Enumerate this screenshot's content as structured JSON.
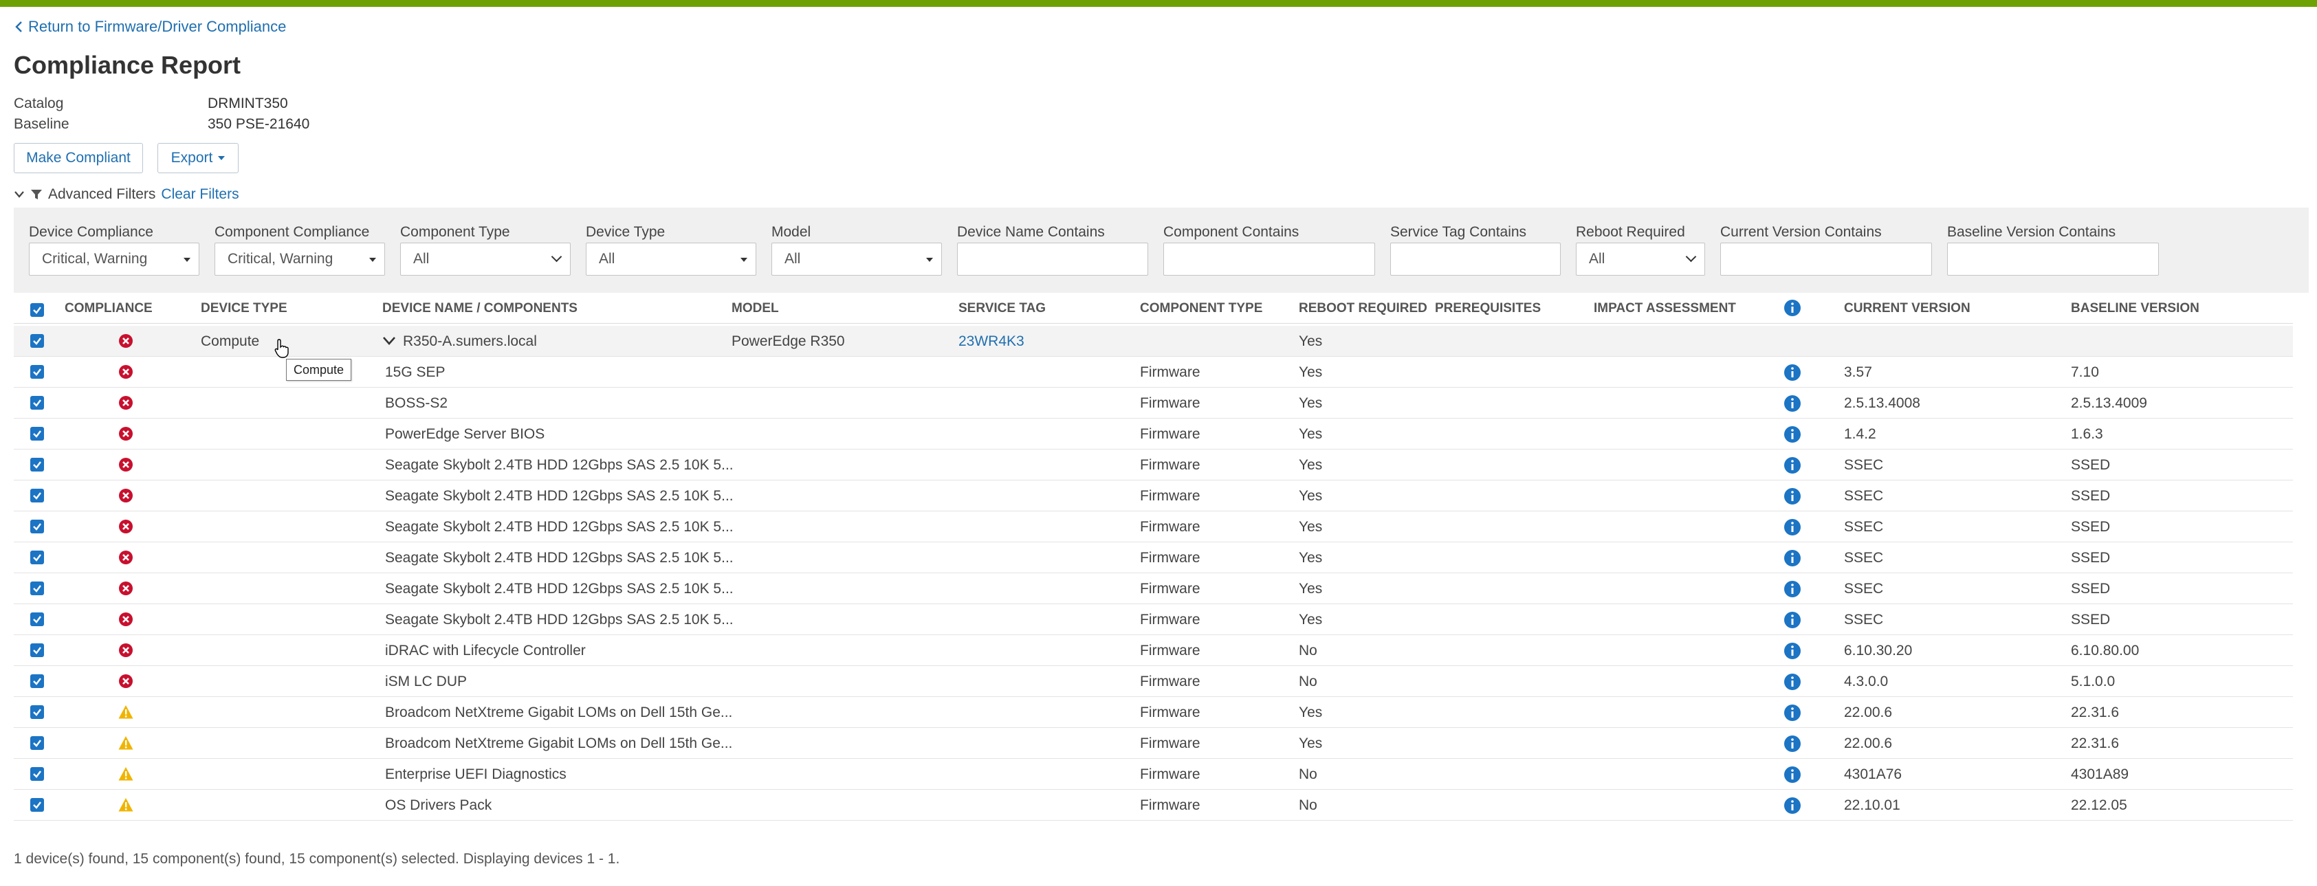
{
  "colors": {
    "accent": "#6ea204",
    "link": "#1f6fb0",
    "critical": "#c8102e",
    "warning": "#f0b400",
    "info": "#1c74c4"
  },
  "back_link": "Return to Firmware/Driver Compliance",
  "title": "Compliance Report",
  "meta": [
    {
      "label": "Catalog",
      "value": "DRMINT350"
    },
    {
      "label": "Baseline",
      "value": "350 PSE-21640"
    }
  ],
  "toolbar": {
    "make_compliant": "Make Compliant",
    "export": "Export"
  },
  "advanced_filters": {
    "label": "Advanced Filters",
    "clear": "Clear Filters"
  },
  "filters": [
    {
      "label": "Device Compliance",
      "value": "Critical, Warning"
    },
    {
      "label": "Component Compliance",
      "value": "Critical, Warning"
    },
    {
      "label": "Component Type",
      "value": "All"
    },
    {
      "label": "Device Type",
      "value": "All"
    },
    {
      "label": "Model",
      "value": "All"
    },
    {
      "label": "Device Name Contains",
      "value": ""
    },
    {
      "label": "Component Contains",
      "value": ""
    },
    {
      "label": "Service Tag Contains",
      "value": ""
    },
    {
      "label": "Reboot Required",
      "value": "All"
    },
    {
      "label": "Current Version Contains",
      "value": ""
    },
    {
      "label": "Baseline Version Contains",
      "value": ""
    }
  ],
  "columns": {
    "compliance": "COMPLIANCE",
    "device_type": "DEVICE TYPE",
    "device_name": "DEVICE NAME / COMPONENTS",
    "model": "MODEL",
    "service_tag": "SERVICE TAG",
    "component_type": "COMPONENT TYPE",
    "reboot": "REBOOT REQUIRED",
    "prereq": "PREREQUISITES",
    "impact": "IMPACT ASSESSMENT",
    "current": "CURRENT VERSION",
    "baseline": "BASELINE VERSION"
  },
  "device": {
    "status": "critical",
    "device_type": "Compute",
    "name": "R350-A.sumers.local",
    "model": "PowerEdge R350",
    "service_tag": "23WR4K3",
    "reboot": "Yes"
  },
  "components": [
    {
      "status": "critical",
      "name": "15G SEP",
      "type": "Firmware",
      "reboot": "Yes",
      "current": "3.57",
      "baseline": "7.10"
    },
    {
      "status": "critical",
      "name": "BOSS-S2",
      "type": "Firmware",
      "reboot": "Yes",
      "current": "2.5.13.4008",
      "baseline": "2.5.13.4009"
    },
    {
      "status": "critical",
      "name": "PowerEdge Server BIOS",
      "type": "Firmware",
      "reboot": "Yes",
      "current": "1.4.2",
      "baseline": "1.6.3"
    },
    {
      "status": "critical",
      "name": "Seagate Skybolt 2.4TB HDD 12Gbps SAS 2.5 10K 5...",
      "type": "Firmware",
      "reboot": "Yes",
      "current": "SSEC",
      "baseline": "SSED"
    },
    {
      "status": "critical",
      "name": "Seagate Skybolt 2.4TB HDD 12Gbps SAS 2.5 10K 5...",
      "type": "Firmware",
      "reboot": "Yes",
      "current": "SSEC",
      "baseline": "SSED"
    },
    {
      "status": "critical",
      "name": "Seagate Skybolt 2.4TB HDD 12Gbps SAS 2.5 10K 5...",
      "type": "Firmware",
      "reboot": "Yes",
      "current": "SSEC",
      "baseline": "SSED"
    },
    {
      "status": "critical",
      "name": "Seagate Skybolt 2.4TB HDD 12Gbps SAS 2.5 10K 5...",
      "type": "Firmware",
      "reboot": "Yes",
      "current": "SSEC",
      "baseline": "SSED"
    },
    {
      "status": "critical",
      "name": "Seagate Skybolt 2.4TB HDD 12Gbps SAS 2.5 10K 5...",
      "type": "Firmware",
      "reboot": "Yes",
      "current": "SSEC",
      "baseline": "SSED"
    },
    {
      "status": "critical",
      "name": "Seagate Skybolt 2.4TB HDD 12Gbps SAS 2.5 10K 5...",
      "type": "Firmware",
      "reboot": "Yes",
      "current": "SSEC",
      "baseline": "SSED"
    },
    {
      "status": "critical",
      "name": "iDRAC with Lifecycle Controller",
      "type": "Firmware",
      "reboot": "No",
      "current": "6.10.30.20",
      "baseline": "6.10.80.00"
    },
    {
      "status": "critical",
      "name": "iSM LC DUP",
      "type": "Firmware",
      "reboot": "No",
      "current": "4.3.0.0",
      "baseline": "5.1.0.0"
    },
    {
      "status": "warning",
      "name": "Broadcom NetXtreme Gigabit LOMs on Dell 15th Ge...",
      "type": "Firmware",
      "reboot": "Yes",
      "current": "22.00.6",
      "baseline": "22.31.6"
    },
    {
      "status": "warning",
      "name": "Broadcom NetXtreme Gigabit LOMs on Dell 15th Ge...",
      "type": "Firmware",
      "reboot": "Yes",
      "current": "22.00.6",
      "baseline": "22.31.6"
    },
    {
      "status": "warning",
      "name": "Enterprise UEFI Diagnostics",
      "type": "Firmware",
      "reboot": "No",
      "current": "4301A76",
      "baseline": "4301A89"
    },
    {
      "status": "warning",
      "name": "OS Drivers Pack",
      "type": "Firmware",
      "reboot": "No",
      "current": "22.10.01",
      "baseline": "22.12.05"
    }
  ],
  "tooltip": "Compute",
  "footer": "1 device(s) found, 15 component(s) found, 15 component(s) selected. Displaying devices 1 - 1."
}
